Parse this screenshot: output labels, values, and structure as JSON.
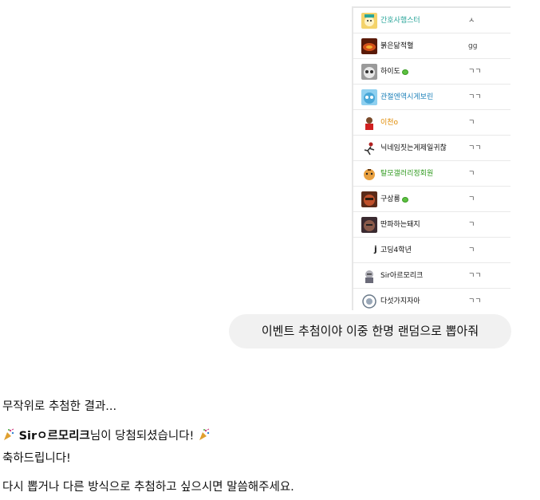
{
  "shared_image": {
    "rows": [
      {
        "nick": "간호사햄스터",
        "comment": "ㅅ",
        "nick_color": "#2aa59a",
        "badge": false
      },
      {
        "nick": "붉은닮적혈",
        "comment": "gg",
        "nick_color": "#333333",
        "badge": false
      },
      {
        "nick": "하이도",
        "comment": "ㄱㄱ",
        "nick_color": "#333333",
        "badge": true
      },
      {
        "nick": "관절엔역시게보린",
        "comment": "ㄱㄱ",
        "nick_color": "#1a7fb8",
        "badge": false
      },
      {
        "nick": "이천o",
        "comment": "ㄱ",
        "nick_color": "#e08a00",
        "badge": false
      },
      {
        "nick": "닉네임짓는게제일귀찮",
        "comment": "ㄱㄱ",
        "nick_color": "#333333",
        "badge": false
      },
      {
        "nick": "탈모갤러리정회원",
        "comment": "ㄱ",
        "nick_color": "#2f9a1e",
        "badge": false
      },
      {
        "nick": "구상룡",
        "comment": "ㄱ",
        "nick_color": "#333333",
        "badge": true
      },
      {
        "nick": "딴파하는돼지",
        "comment": "ㄱ",
        "nick_color": "#333333",
        "badge": false
      },
      {
        "nick": "고딩4학년",
        "comment": "ㄱ",
        "nick_color": "#333333",
        "badge": false,
        "prefix": "j"
      },
      {
        "nick": "Sir아르모리크",
        "comment": "ㄱㄱ",
        "nick_color": "#333333",
        "badge": false
      },
      {
        "nick": "다섯가지자아",
        "comment": "ㄱㄱ",
        "nick_color": "#333333",
        "badge": false
      }
    ]
  },
  "user_message": "이벤트 추첨이야 이중 한명 랜덤으로 뽑아줘",
  "assistant": {
    "line1": "무작위로 추첨한 결과...",
    "winner_name": "Sirㅇ르모리크",
    "winner_suffix": "님이 당첨되셨습니다!",
    "line3": "축하드립니다!",
    "line4": "다시 뽑거나 다른 방식으로 추첨하고 싶으시면 말씀해주세요."
  }
}
